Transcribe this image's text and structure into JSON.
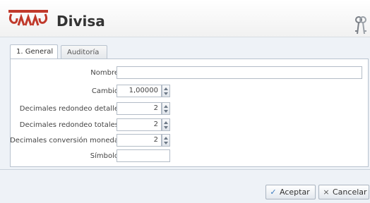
{
  "window": {
    "title": "Divisa"
  },
  "tabs": [
    {
      "label": "1. General",
      "active": true
    },
    {
      "label": "Auditoría",
      "active": false
    }
  ],
  "form": {
    "nombre": {
      "label": "Nombre",
      "value": ""
    },
    "cambio": {
      "label": "Cambio",
      "value": "1,00000"
    },
    "decimales_detalle": {
      "label": "Decimales redondeo detalle",
      "value": "2"
    },
    "decimales_totales": {
      "label": "Decimales redondeo totales",
      "value": "2"
    },
    "decimales_conversion": {
      "label": "Decimales conversión moneda",
      "value": "2"
    },
    "simbolo": {
      "label": "Símbolo",
      "value": ""
    }
  },
  "buttons": {
    "accept": {
      "label": "Aceptar",
      "icon": "check-icon"
    },
    "cancel": {
      "label": "Cancelar",
      "icon": "x-icon"
    }
  },
  "colors": {
    "brand": "#c0392b",
    "accent": "#3a7abf"
  }
}
